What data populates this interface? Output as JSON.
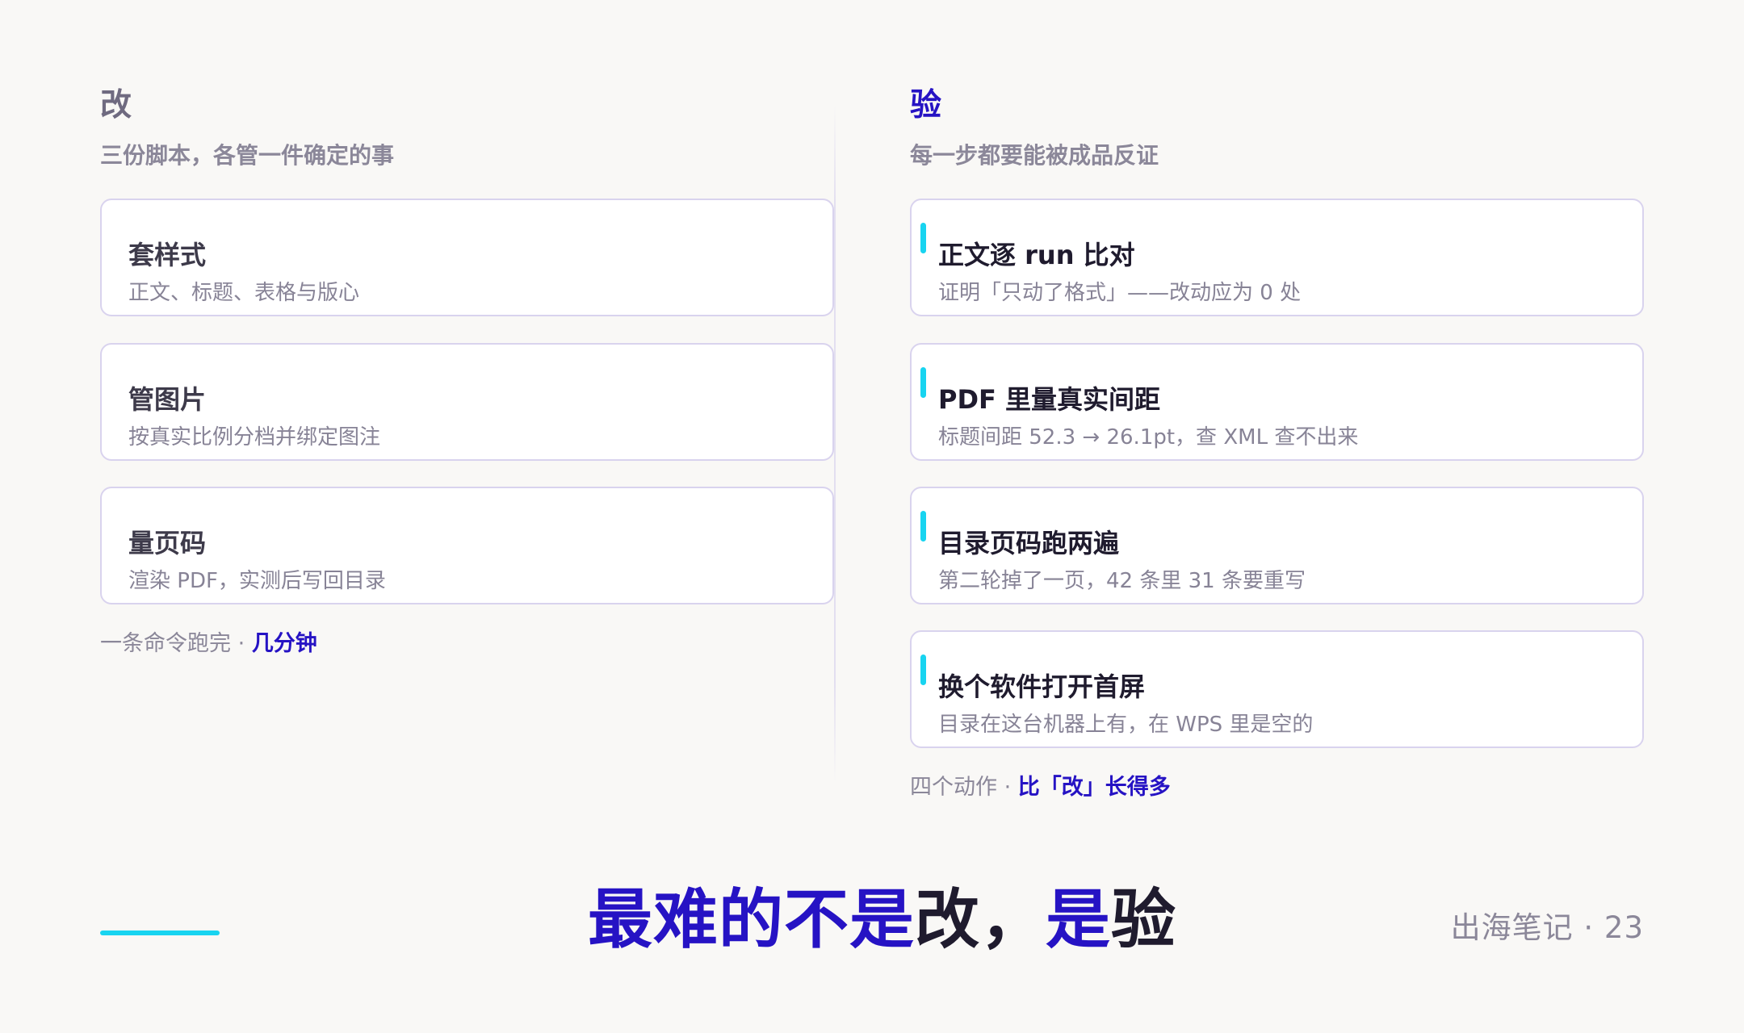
{
  "left": {
    "title": "改",
    "subtitle": "三份脚本，各管一件确定的事",
    "cards": [
      {
        "title": "套样式",
        "desc": "正文、标题、表格与版心"
      },
      {
        "title": "管图片",
        "desc": "按真实比例分档并绑定图注"
      },
      {
        "title": "量页码",
        "desc": "渲染 PDF，实测后写回目录"
      }
    ],
    "footer_prefix": "一条命令跑完 · ",
    "footer_highlight": "几分钟"
  },
  "right": {
    "title": "验",
    "subtitle": "每一步都要能被成品反证",
    "cards": [
      {
        "title": "正文逐 run 比对",
        "desc": "证明「只动了格式」——改动应为 0 处"
      },
      {
        "title": "PDF 里量真实间距",
        "desc": "标题间距 52.3 → 26.1pt，查 XML 查不出来"
      },
      {
        "title": "目录页码跑两遍",
        "desc": "第二轮掉了一页，42 条里 31 条要重写"
      },
      {
        "title": "换个软件打开首屏",
        "desc": "目录在这台机器上有，在 WPS 里是空的"
      }
    ],
    "footer_prefix": "四个动作 · ",
    "footer_highlight": "比「改」长得多"
  },
  "headline": {
    "part1": "最难的不是",
    "part2": "改，",
    "part3": "是",
    "part4": "验"
  },
  "footer": {
    "brand_page": "出海笔记 · 23"
  },
  "colors": {
    "accent_blue": "#2613c4",
    "accent_cyan": "#18d4f0",
    "background": "#f9f8f6"
  }
}
